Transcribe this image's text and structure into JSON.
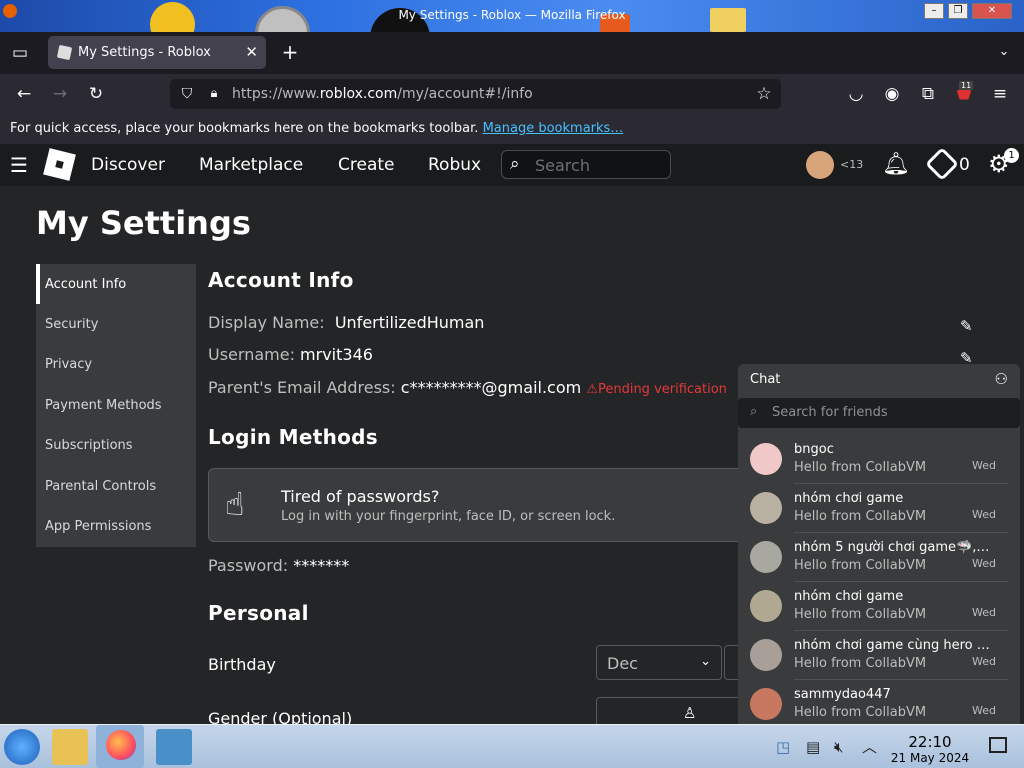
{
  "window": {
    "title": "My Settings - Roblox — Mozilla Firefox"
  },
  "browser": {
    "tab_title": "My Settings - Roblox",
    "url_prefix": "https://www.",
    "url_domain": "roblox.com",
    "url_path": "/my/account#!/info",
    "bookmarks_msg": "For quick access, place your bookmarks here on the bookmarks toolbar.",
    "bookmarks_link": "Manage bookmarks…",
    "extension_badge": "11"
  },
  "roblox_header": {
    "nav": [
      "Discover",
      "Marketplace",
      "Create",
      "Robux"
    ],
    "search_placeholder": "Search",
    "age_label": "<13",
    "robux_count": "0",
    "settings_badge": "1"
  },
  "page": {
    "title": "My Settings",
    "menu": [
      "Account Info",
      "Security",
      "Privacy",
      "Payment Methods",
      "Subscriptions",
      "Parental Controls",
      "App Permissions"
    ],
    "account_info": {
      "heading": "Account Info",
      "display_name_label": "Display Name:",
      "display_name": "UnfertilizedHuman",
      "username_label": "Username:",
      "username": "mrvit346",
      "email_label": "Parent's Email Address:",
      "email": "c*********@gmail.com",
      "email_status": "Pending verification"
    },
    "login": {
      "heading": "Login Methods",
      "title": "Tired of passwords?",
      "subtitle": "Log in with your fingerprint, face ID, or screen lock.",
      "password_label": "Password:",
      "password": "*******"
    },
    "personal": {
      "heading": "Personal",
      "birthday_label": "Birthday",
      "birthday_month": "Dec",
      "gender_label": "Gender (Optional)"
    }
  },
  "chat": {
    "title": "Chat",
    "search_placeholder": "Search for friends",
    "items": [
      {
        "name": "bngoc",
        "message": "Hello from CollabVM",
        "date": "Wed"
      },
      {
        "name": "nhóm chơi game",
        "message": "Hello from CollabVM",
        "date": "Wed"
      },
      {
        "name": "nhóm 5 người chơi game🦈,🐺,...",
        "message": "Hello from CollabVM",
        "date": "Wed"
      },
      {
        "name": "nhóm chơi game",
        "message": "Hello from CollabVM",
        "date": "Wed"
      },
      {
        "name": "nhóm chơi game cùng hero te...",
        "message": "Hello from CollabVM",
        "date": "Wed"
      },
      {
        "name": "sammydao447",
        "message": "Hello from CollabVM",
        "date": "Wed"
      }
    ]
  },
  "taskbar": {
    "time": "22:10",
    "date": "21 May 2024"
  }
}
